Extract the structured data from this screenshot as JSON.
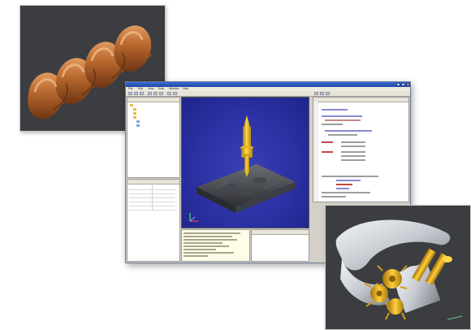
{
  "renders": {
    "screw": {
      "icon": "helical-screw-render"
    },
    "assembly": {
      "icon": "gear-assembly-render"
    }
  },
  "app": {
    "title": "",
    "menus": [
      "File",
      "Edit",
      "View",
      "Tools",
      "Window",
      "Help"
    ],
    "toolbar_icons": [
      "new-icon",
      "open-icon",
      "save-icon",
      "cut-icon",
      "copy-icon",
      "paste-icon",
      "undo-icon",
      "redo-icon"
    ],
    "tree": {
      "items": [
        {
          "label": ""
        },
        {
          "label": ""
        },
        {
          "label": ""
        },
        {
          "label": ""
        },
        {
          "label": ""
        },
        {
          "label": ""
        }
      ]
    },
    "code": {
      "lines": [
        "",
        "",
        "",
        "",
        "",
        "",
        "",
        "",
        "",
        "",
        "",
        "",
        "",
        "",
        "",
        "",
        "",
        "",
        "",
        ""
      ]
    },
    "console": {
      "lines": [
        "",
        "",
        "",
        "",
        "",
        "",
        "",
        ""
      ]
    }
  },
  "colors": {
    "viewport_bg": "#2a2fa1",
    "render_bg": "#3b3d41",
    "gold": "#e5b321",
    "bronze": "#b5652b"
  }
}
